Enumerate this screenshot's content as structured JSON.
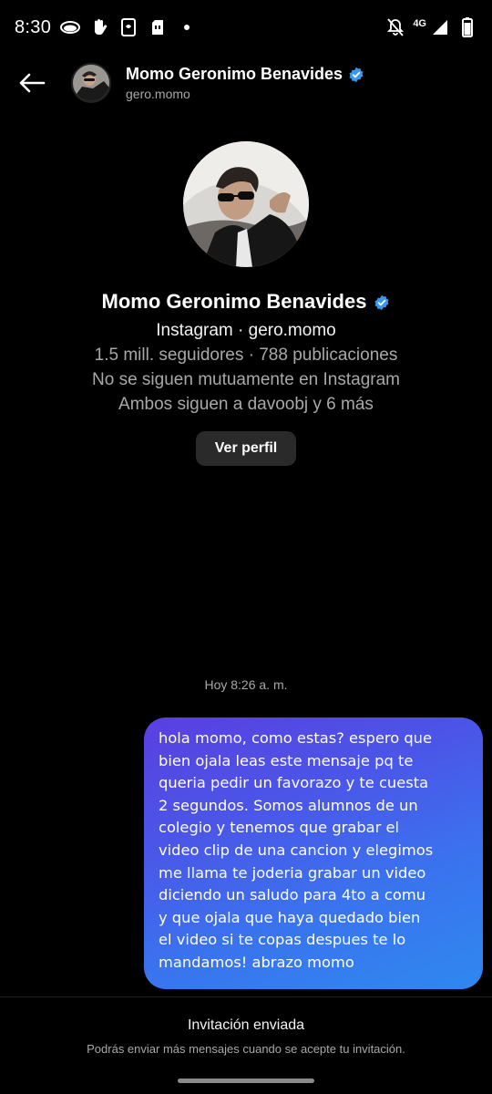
{
  "status_bar": {
    "time": "8:30",
    "network": "4G",
    "icons": [
      "eye-icon",
      "hand-icon",
      "phone-clip-icon",
      "sim-card-icon",
      "notification-dot-icon",
      "bell-off-icon",
      "signal-icon",
      "battery-icon"
    ]
  },
  "header": {
    "name": "Momo Geronimo Benavides",
    "handle": "gero.momo",
    "verified": true
  },
  "profile": {
    "name": "Momo Geronimo Benavides",
    "platform_line": "Instagram · gero.momo",
    "stats_line": "1.5 mill. seguidores · 788 publicaciones",
    "follow_line": "No se siguen mutuamente en Instagram",
    "mutual_line": "Ambos siguen a davoobj y 6 más",
    "view_profile_label": "Ver perfil"
  },
  "chat": {
    "timestamp": "Hoy 8:26 a. m.",
    "message": "hola momo, como estas? espero que\nbien ojala leas este mensaje pq te\nqueria pedir un favorazo y te cuesta\n2 segundos. Somos alumnos de un\ncolegio y tenemos que grabar el\nvideo clip de una cancion y elegimos\nme llama te joderia grabar un video\ndiciendo un saludo para 4to a comu\ny que ojala que haya quedado bien\nel video si te copas despues te lo\nmandamos! abrazo momo"
  },
  "footer": {
    "title": "Invitación enviada",
    "subtitle": "Podrás enviar más mensajes cuando se acepte tu invitación."
  },
  "colors": {
    "background": "#000000",
    "verified_blue": "#3897f0",
    "bubble_start": "#5a3fe0",
    "bubble_end": "#2f88f0",
    "secondary_text": "#a8a8a8"
  }
}
